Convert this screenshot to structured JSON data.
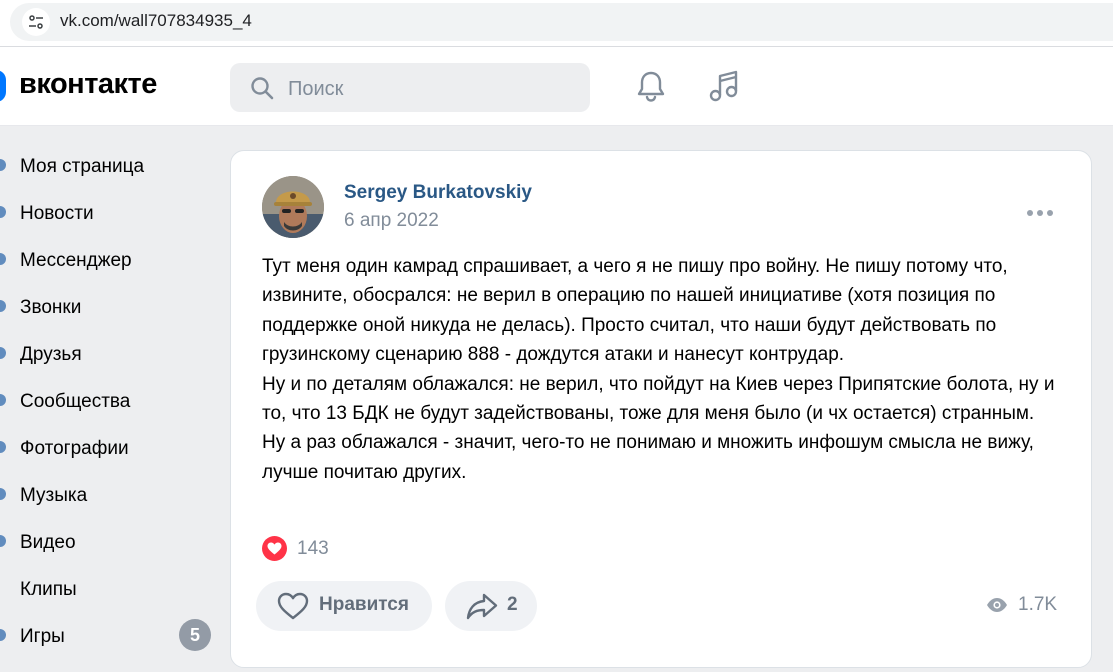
{
  "browser": {
    "url": "vk.com/wall707834935_4"
  },
  "header": {
    "logo_text": "вконтакте",
    "search_placeholder": "Поиск"
  },
  "sidebar": {
    "items": [
      {
        "label": "Моя страница"
      },
      {
        "label": "Новости"
      },
      {
        "label": "Мессенджер"
      },
      {
        "label": "Звонки"
      },
      {
        "label": "Друзья"
      },
      {
        "label": "Сообщества"
      },
      {
        "label": "Фотографии"
      },
      {
        "label": "Музыка"
      },
      {
        "label": "Видео"
      },
      {
        "label": "Клипы"
      },
      {
        "label": "Игры",
        "badge": "5"
      }
    ]
  },
  "post": {
    "author": "Sergey Burkatovskiy",
    "date": "6 апр 2022",
    "paragraphs": [
      "Тут меня один камрад спрашивает, а чего я не пишу про войну. Не пишу потому что, извините, обосрался: не верил в операцию по нашей инициативе (хотя позиция по поддержке оной никуда не делась). Просто считал, что наши будут действовать по грузинскому сценарию 888 - дождутся атаки и нанесут контрудар.",
      "Ну и по деталям облажался: не верил, что пойдут на Киев через Припятские болота, ну и то, что 13 БДК не будут задействованы, тоже для меня было (и чх остается) странным.",
      "Ну а раз облажался - значит, чего-то не понимаю и множить инфошум смысла не вижу, лучше почитаю других."
    ],
    "reactions_count": "143",
    "like_label": "Нравится",
    "share_count": "2",
    "views": "1.7K"
  },
  "colors": {
    "vk_blue": "#0077ff",
    "link": "#2a5885",
    "heart": "#ff3347",
    "secondary_text": "#818c99"
  }
}
